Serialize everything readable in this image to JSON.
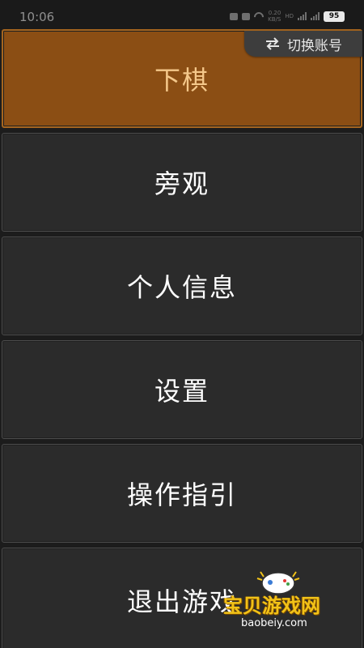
{
  "status_bar": {
    "time": "10:06",
    "network_speed_top": "0.20",
    "network_speed_bottom": "KB/S",
    "signal_label": "HD",
    "battery": "95"
  },
  "switch_account": {
    "label": "切换账号",
    "icon": "swap-arrows-icon"
  },
  "menu": {
    "items": [
      {
        "label": "下棋",
        "active": true
      },
      {
        "label": "旁观",
        "active": false
      },
      {
        "label": "个人信息",
        "active": false
      },
      {
        "label": "设置",
        "active": false
      },
      {
        "label": "操作指引",
        "active": false
      },
      {
        "label": "退出游戏",
        "active": false
      }
    ]
  },
  "watermark": {
    "title": "宝贝游戏网",
    "url": "baobeiy.com"
  },
  "colors": {
    "background": "#1c1c1c",
    "menu_item_bg": "#2b2b2b",
    "active_item_bg": "#8b4e14",
    "active_item_text": "#f4c78a",
    "text": "#ffffff",
    "watermark_title": "#f2c318"
  }
}
